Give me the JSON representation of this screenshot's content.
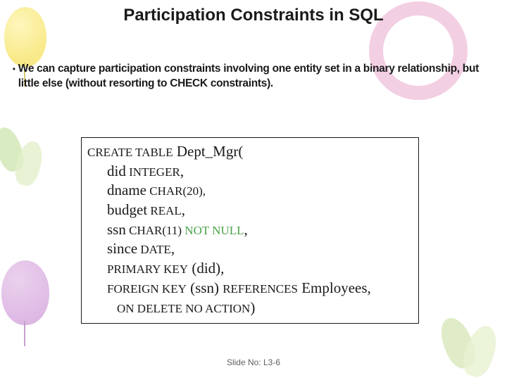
{
  "title": "Participation Constraints in SQL",
  "bullet": "We can capture participation constraints involving one entity set in a binary relationship, but little else (without resorting to CHECK constraints).",
  "code": {
    "l1a": "CREATE TABLE",
    "l1b": "  Dept_Mgr(",
    "l2a": "did",
    "l2b": "  INTEGER",
    "l2c": ",",
    "l3a": "dname",
    "l3b": "  CHAR(20),",
    "l4a": "budget",
    "l4b": "  REAL",
    "l4c": ",",
    "l5a": "ssn",
    "l5b": "  CHAR(11) ",
    "l5c": "NOT NULL",
    "l5d": ",",
    "l6a": "since",
    "l6b": "  DATE",
    "l6c": ",",
    "l7a": "PRIMARY KEY",
    "l7b": "  (did),",
    "l8a": "FOREIGN KEY",
    "l8b": "  (ssn) ",
    "l8c": "REFERENCES",
    "l8d": " Employees,",
    "l9a": "ON DELETE NO ACTION",
    "l9b": ")"
  },
  "footer": "Slide No: L3-6"
}
